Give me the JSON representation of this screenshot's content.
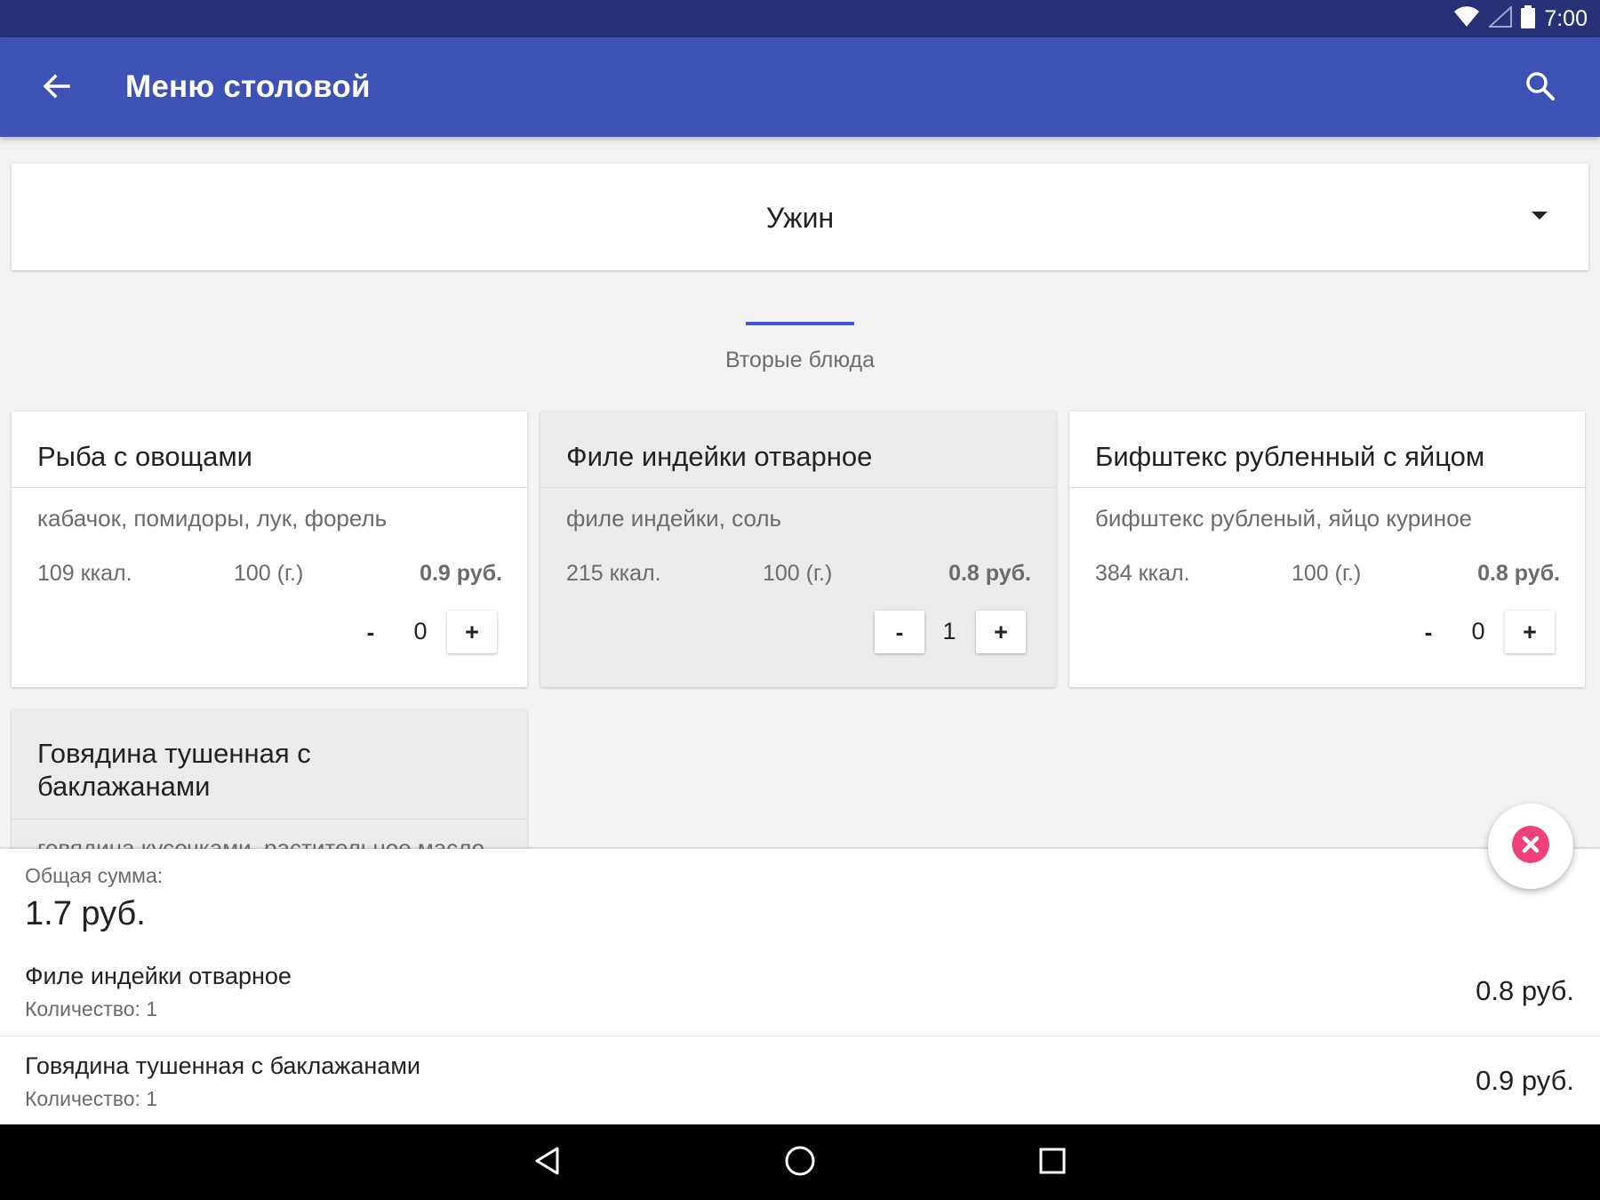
{
  "status_bar": {
    "time": "7:00",
    "icons": [
      "wifi-icon",
      "signal-icon",
      "battery-icon"
    ]
  },
  "app_bar": {
    "title": "Меню столовой",
    "back_icon": "arrow-back-icon",
    "search_icon": "search-icon"
  },
  "meal_spinner": {
    "selected": "Ужин"
  },
  "section": {
    "title": "Вторые блюда"
  },
  "dishes": [
    {
      "name": "Рыба с овощами",
      "ingredients": "кабачок, помидоры, лук, форель",
      "kcal": "109 ккал.",
      "weight": "100 (г.)",
      "price": "0.9 руб.",
      "count": "0",
      "minus": "-",
      "plus": "+",
      "selected": false
    },
    {
      "name": "Филе индейки отварное",
      "ingredients": "филе индейки, соль",
      "kcal": "215 ккал.",
      "weight": "100 (г.)",
      "price": "0.8 руб.",
      "count": "1",
      "minus": "-",
      "plus": "+",
      "selected": true
    },
    {
      "name": "Бифштекс рубленный с яйцом",
      "ingredients": "бифштекс рубленый, яйцо куриное",
      "kcal": "384 ккал.",
      "weight": "100 (г.)",
      "price": "0.8 руб.",
      "count": "0",
      "minus": "-",
      "plus": "+",
      "selected": false
    },
    {
      "name": "Говядина тушенная с баклажанами",
      "ingredients": "говядина кусочками, растительное масло",
      "selected": true
    }
  ],
  "order_sheet": {
    "total_label": "Общая сумма:",
    "total_value": "1.7 руб.",
    "items": [
      {
        "name": "Филе индейки отварное",
        "qty": "Количество: 1",
        "sum": "0.8 руб."
      },
      {
        "name": "Говядина тушенная с баклажанами",
        "qty": "Количество: 1",
        "sum": "0.9 руб."
      }
    ]
  },
  "fab": {
    "icon": "close-icon",
    "color": "#f0407a"
  },
  "colors": {
    "primary": "#3e51b5",
    "primary_dark": "#283077",
    "accent": "#f0407a",
    "indicator": "#3e5bd9"
  }
}
